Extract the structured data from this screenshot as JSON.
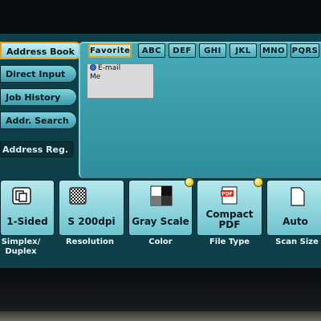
{
  "side_menu": {
    "items": [
      {
        "label": "Address Book",
        "active": true
      },
      {
        "label": "Direct Input",
        "active": false
      },
      {
        "label": "Job History",
        "active": false
      },
      {
        "label": "Addr. Search",
        "active": false
      }
    ],
    "address_reg": "Address Reg."
  },
  "tabs": [
    "Favorite",
    "ABC",
    "DEF",
    "GHI",
    "JKL",
    "MNO",
    "PQRS"
  ],
  "destination_list": {
    "items": [
      {
        "label": "E-mail",
        "icon": "globe-icon"
      },
      {
        "label": "Me"
      }
    ]
  },
  "settings": [
    {
      "value": "1-Sided",
      "caption": "Simplex/\nDuplex",
      "icon": "simplex-icon"
    },
    {
      "value": "S 200dpi",
      "caption": "Resolution",
      "icon": "resolution-icon"
    },
    {
      "value": "Gray Scale",
      "caption": "Color",
      "icon": "grayscale-icon"
    },
    {
      "value": "Compact\nPDF",
      "caption": "File Type",
      "icon": "pdf-icon"
    },
    {
      "value": "Auto",
      "caption": "Scan Size",
      "icon": "page-icon"
    }
  ],
  "colors": {
    "screen_bg": "#0f3f48",
    "button_teal": "#4ba8b7",
    "selected_border": "#e0a020"
  }
}
